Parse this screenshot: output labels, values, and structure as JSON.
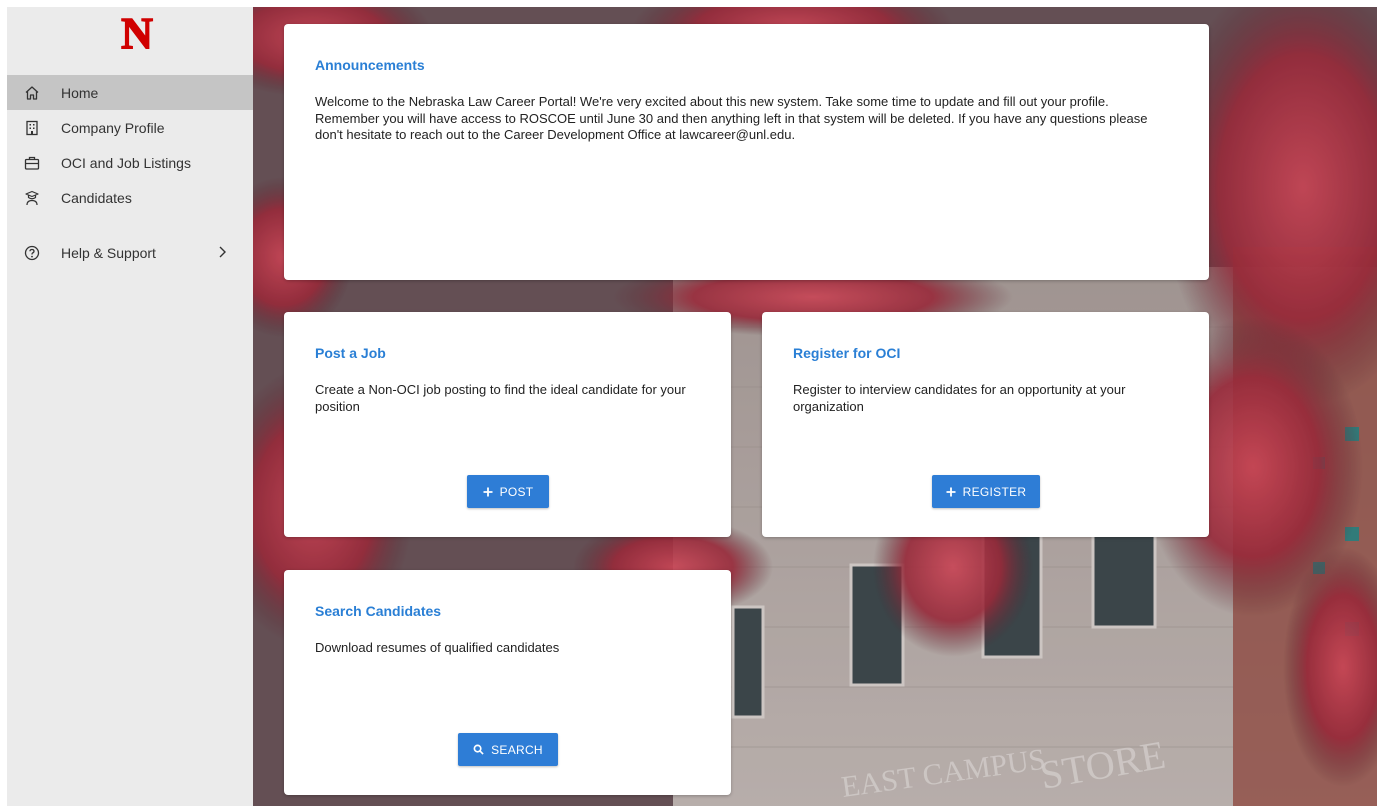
{
  "brand": {
    "logo_letter": "N",
    "logo_color": "#d00000"
  },
  "sidebar": {
    "items": [
      {
        "label": "Home",
        "icon": "home-icon",
        "active": true
      },
      {
        "label": "Company Profile",
        "icon": "building-icon"
      },
      {
        "label": "OCI and Job Listings",
        "icon": "briefcase-icon"
      },
      {
        "label": "Candidates",
        "icon": "graduate-icon"
      }
    ],
    "help": {
      "label": "Help & Support",
      "icon": "help-circle-icon"
    }
  },
  "background": {
    "sign_text": "EAST CAMPUS",
    "sign_text_2": "STORE"
  },
  "announcements": {
    "title": "Announcements",
    "body": "Welcome to the Nebraska Law Career Portal! We're very excited about this new system. Take some time to update and fill out your profile. Remember you will have access to ROSCOE until June 30 and then anything left in that system will be deleted. If you have any questions please don't hesitate to reach out to the Career Development Office at lawcareer@unl.edu."
  },
  "post_job": {
    "title": "Post a Job",
    "body": "Create a Non-OCI job posting to find the ideal candidate for your position",
    "button": "POST"
  },
  "register_oci": {
    "title": "Register for OCI",
    "body": "Register to interview candidates for an opportunity at your organization",
    "button": "REGISTER"
  },
  "search_candidates": {
    "title": "Search Candidates",
    "body": "Download resumes of qualified candidates",
    "button": "SEARCH"
  },
  "colors": {
    "accent": "#2e7dd6",
    "title": "#2a7fd5",
    "sidebar_bg": "#ebebeb",
    "active_bg": "#c5c5c5"
  }
}
